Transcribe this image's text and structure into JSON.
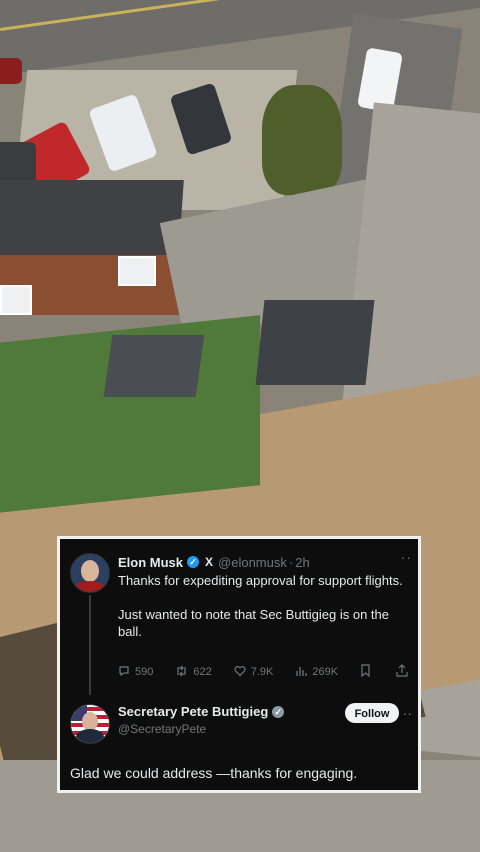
{
  "tweet1": {
    "name": "Elon Musk",
    "handle": "@elonmusk",
    "time": "2h",
    "x_logo": "X",
    "text_line1": "Thanks for expediting approval for support flights.",
    "text_line2": "Just wanted to note that Sec Buttigieg is on the ball.",
    "replies": "590",
    "reposts": "622",
    "likes": "7.9K",
    "views": "269K"
  },
  "tweet2": {
    "name": "Secretary Pete Buttigieg",
    "handle": "@SecretaryPete",
    "follow_label": "Follow",
    "text": "Glad we could address —thanks for engaging."
  },
  "icons": {
    "reply": "reply-icon",
    "repost": "repost-icon",
    "like": "heart-icon",
    "views": "views-icon",
    "bookmark": "bookmark-icon",
    "share": "share-icon"
  },
  "colors": {
    "card_bg": "#0d0d0d",
    "verified_blue": "#1d9bf0",
    "verified_grey": "#8b98a5",
    "muted_text": "#71767b",
    "follow_button": "#eff3f4"
  }
}
